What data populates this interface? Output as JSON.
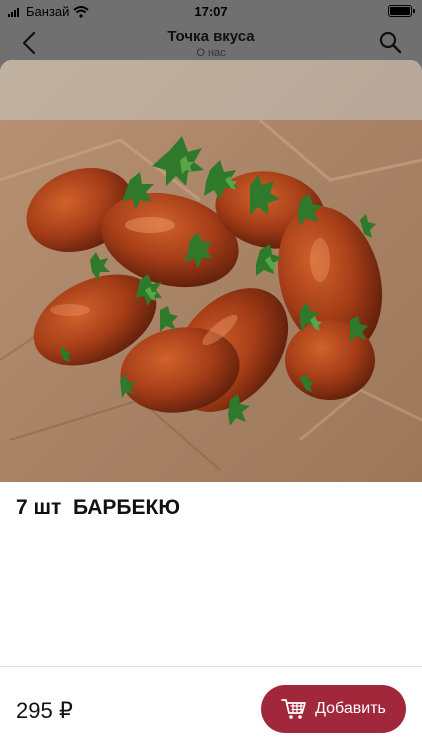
{
  "status_bar": {
    "carrier": "Банзай",
    "time": "17:07"
  },
  "nav": {
    "title": "Точка вкуса",
    "subtitle": "О нас"
  },
  "product": {
    "name": "7 шт  БАРБЕКЮ",
    "image_icon": "product-photo",
    "price": "295 ₽"
  },
  "actions": {
    "add_label": "Добавить",
    "add_icon": "cart-icon"
  },
  "colors": {
    "accent": "#a1283a",
    "overlay": "#707070"
  }
}
